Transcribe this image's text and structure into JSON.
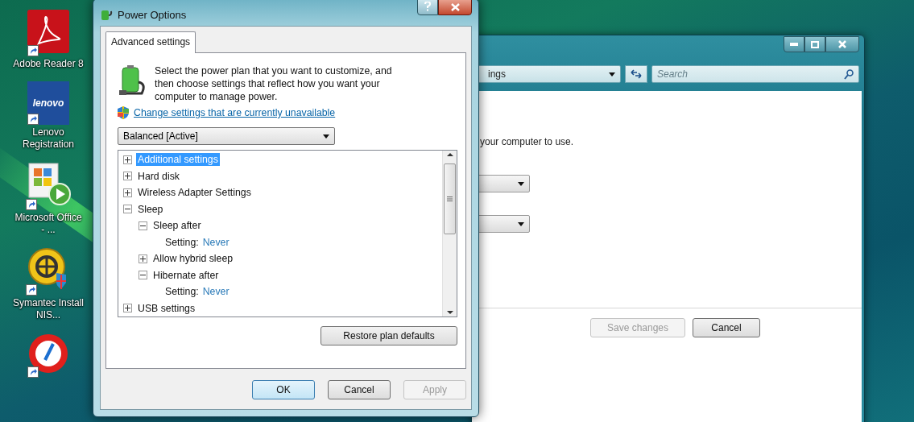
{
  "desktop_icons": [
    {
      "kind": "pdf",
      "label": "Adobe Reader 8"
    },
    {
      "kind": "brand",
      "logo_text": "lenovo",
      "label": "Lenovo Registration"
    },
    {
      "kind": "office",
      "label": "Microsoft Office - ..."
    },
    {
      "kind": "security",
      "label": "Symantec Install NIS..."
    },
    {
      "kind": "gauge"
    }
  ],
  "back_window": {
    "address": "ings",
    "search": {
      "placeholder": "Search"
    },
    "text": "your computer to use.",
    "dropdowns": [
      {
        "kind": "combo"
      },
      {
        "kind": "combo"
      }
    ],
    "buttons": [
      {
        "label": "Save changes",
        "disabled": true
      },
      {
        "label": "Cancel",
        "disabled": false
      }
    ]
  },
  "dialog": {
    "title": "Power Options",
    "tabs": [
      {
        "label": "Advanced settings",
        "selected": true
      }
    ],
    "description": "Select the power plan that you want to customize, and then choose settings that reflect how you want your computer to manage power.",
    "link": "Change settings that are currently unavailable",
    "plan": "Balanced [Active]",
    "tree": [
      {
        "label": "Additional settings",
        "selected": true,
        "expanded": false
      },
      {
        "label": "Hard disk",
        "selected": false,
        "expanded": false
      },
      {
        "label": "Wireless Adapter Settings",
        "selected": false,
        "expanded": false
      },
      {
        "label": "Sleep",
        "selected": false,
        "expanded": true,
        "children": [
          {
            "label": "Sleep after",
            "selected": false,
            "expanded": true,
            "children": [
              {
                "kind": "setting",
                "label": "Setting:",
                "value": "Never"
              }
            ]
          },
          {
            "label": "Allow hybrid sleep",
            "selected": false,
            "expanded": false
          },
          {
            "label": "Hibernate after",
            "selected": false,
            "expanded": true,
            "children": [
              {
                "kind": "setting",
                "label": "Setting:",
                "value": "Never"
              }
            ]
          }
        ]
      },
      {
        "label": "USB settings",
        "selected": false,
        "expanded": false
      }
    ],
    "restore_button": "Restore plan defaults",
    "buttons": [
      {
        "label": "OK",
        "default": true,
        "disabled": false
      },
      {
        "label": "Cancel",
        "default": false,
        "disabled": false
      },
      {
        "label": "Apply",
        "default": false,
        "disabled": true
      }
    ]
  }
}
